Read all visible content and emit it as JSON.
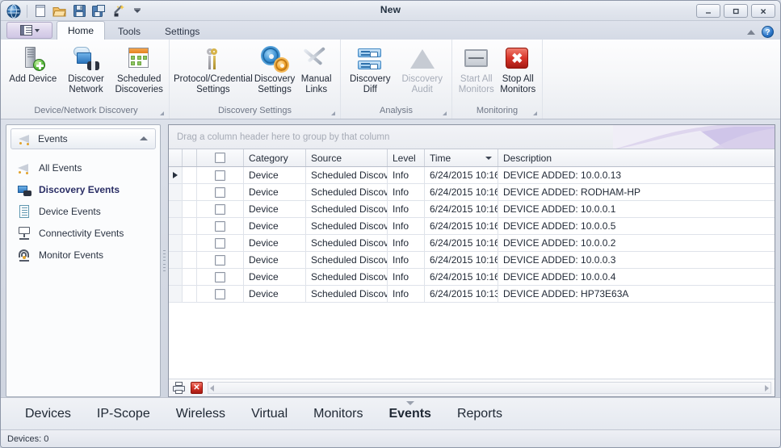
{
  "window": {
    "title": "New",
    "minimize_label": "—",
    "maximize_label": "☐",
    "close_label": "✕"
  },
  "quick_access": [
    {
      "name": "app-menu-icon",
      "label": ""
    },
    {
      "name": "new-icon",
      "label": ""
    },
    {
      "name": "open-icon",
      "label": ""
    },
    {
      "name": "save-icon",
      "label": ""
    },
    {
      "name": "save-as-icon",
      "label": ""
    },
    {
      "name": "wizard-icon",
      "label": ""
    },
    {
      "name": "customize-qat-icon",
      "label": ""
    }
  ],
  "ribbon": {
    "tabs": [
      {
        "label": "Home",
        "active": true
      },
      {
        "label": "Tools",
        "active": false
      },
      {
        "label": "Settings",
        "active": false
      }
    ],
    "help_label": "?",
    "groups": [
      {
        "title": "Device/Network Discovery",
        "items": [
          {
            "label": "Add Device",
            "icon": "add-device-icon",
            "disabled": false,
            "wide": false
          },
          {
            "label": "Discover Network",
            "icon": "discover-network-icon",
            "disabled": false,
            "wide": false
          },
          {
            "label": "Scheduled Discoveries",
            "icon": "scheduled-discoveries-icon",
            "disabled": false,
            "wide": false
          }
        ]
      },
      {
        "title": "Discovery Settings",
        "items": [
          {
            "label": "Protocol/Credential Settings",
            "icon": "keys-icon",
            "disabled": false,
            "wide": true
          },
          {
            "label": "Discovery Settings",
            "icon": "gears-icon",
            "disabled": false,
            "wide": false
          },
          {
            "label": "Manual Links",
            "icon": "manual-links-icon",
            "disabled": false,
            "wide": false
          }
        ]
      },
      {
        "title": "Analysis",
        "items": [
          {
            "label": "Discovery Diff",
            "icon": "discovery-diff-icon",
            "disabled": false,
            "wide": false
          },
          {
            "label": "Discovery Audit",
            "icon": "discovery-audit-icon",
            "disabled": true,
            "wide": false
          }
        ]
      },
      {
        "title": "Monitoring",
        "items": [
          {
            "label": "Start All Monitors",
            "icon": "start-monitors-icon",
            "disabled": true,
            "wide": false
          },
          {
            "label": "Stop All Monitors",
            "icon": "stop-monitors-icon",
            "disabled": false,
            "wide": false
          }
        ]
      }
    ]
  },
  "sidebar": {
    "header": "Events",
    "items": [
      {
        "label": "All Events",
        "icon": "events-icon",
        "selected": false
      },
      {
        "label": "Discovery Events",
        "icon": "discovery-events-icon",
        "selected": true
      },
      {
        "label": "Device Events",
        "icon": "device-events-icon",
        "selected": false
      },
      {
        "label": "Connectivity Events",
        "icon": "connectivity-events-icon",
        "selected": false
      },
      {
        "label": "Monitor Events",
        "icon": "monitor-events-icon",
        "selected": false
      }
    ]
  },
  "grid": {
    "group_hint": "Drag a column header here to group by that column",
    "columns": [
      "Category",
      "Source",
      "Level",
      "Time",
      "Description"
    ],
    "sorted_column": "Time",
    "rows": [
      {
        "category": "Device",
        "source": "Scheduled Discov…",
        "level": "Info",
        "time": "6/24/2015 10:16…",
        "description": "DEVICE ADDED: 10.0.0.13",
        "current": true
      },
      {
        "category": "Device",
        "source": "Scheduled Discov…",
        "level": "Info",
        "time": "6/24/2015 10:16…",
        "description": "DEVICE ADDED: RODHAM-HP",
        "current": false
      },
      {
        "category": "Device",
        "source": "Scheduled Discov…",
        "level": "Info",
        "time": "6/24/2015 10:16…",
        "description": "DEVICE ADDED: 10.0.0.1",
        "current": false
      },
      {
        "category": "Device",
        "source": "Scheduled Discov…",
        "level": "Info",
        "time": "6/24/2015 10:16…",
        "description": "DEVICE ADDED: 10.0.0.5",
        "current": false
      },
      {
        "category": "Device",
        "source": "Scheduled Discov…",
        "level": "Info",
        "time": "6/24/2015 10:16…",
        "description": "DEVICE ADDED: 10.0.0.2",
        "current": false
      },
      {
        "category": "Device",
        "source": "Scheduled Discov…",
        "level": "Info",
        "time": "6/24/2015 10:16…",
        "description": "DEVICE ADDED: 10.0.0.3",
        "current": false
      },
      {
        "category": "Device",
        "source": "Scheduled Discov…",
        "level": "Info",
        "time": "6/24/2015 10:16…",
        "description": "DEVICE ADDED: 10.0.0.4",
        "current": false
      },
      {
        "category": "Device",
        "source": "Scheduled Discov…",
        "level": "Info",
        "time": "6/24/2015 10:13…",
        "description": "DEVICE ADDED: HP73E63A",
        "current": false
      }
    ],
    "footer": {
      "print_label": "",
      "clear_label": "✕"
    }
  },
  "bottom_nav": [
    {
      "label": "Devices",
      "active": false
    },
    {
      "label": "IP-Scope",
      "active": false
    },
    {
      "label": "Wireless",
      "active": false
    },
    {
      "label": "Virtual",
      "active": false
    },
    {
      "label": "Monitors",
      "active": false
    },
    {
      "label": "Events",
      "active": true
    },
    {
      "label": "Reports",
      "active": false
    }
  ],
  "statusbar": {
    "devices_count": "Devices: 0"
  },
  "colors": {
    "accent_purple": "#cdc2e8",
    "selected_text": "#2b2f66",
    "stop_red": "#d53428"
  }
}
